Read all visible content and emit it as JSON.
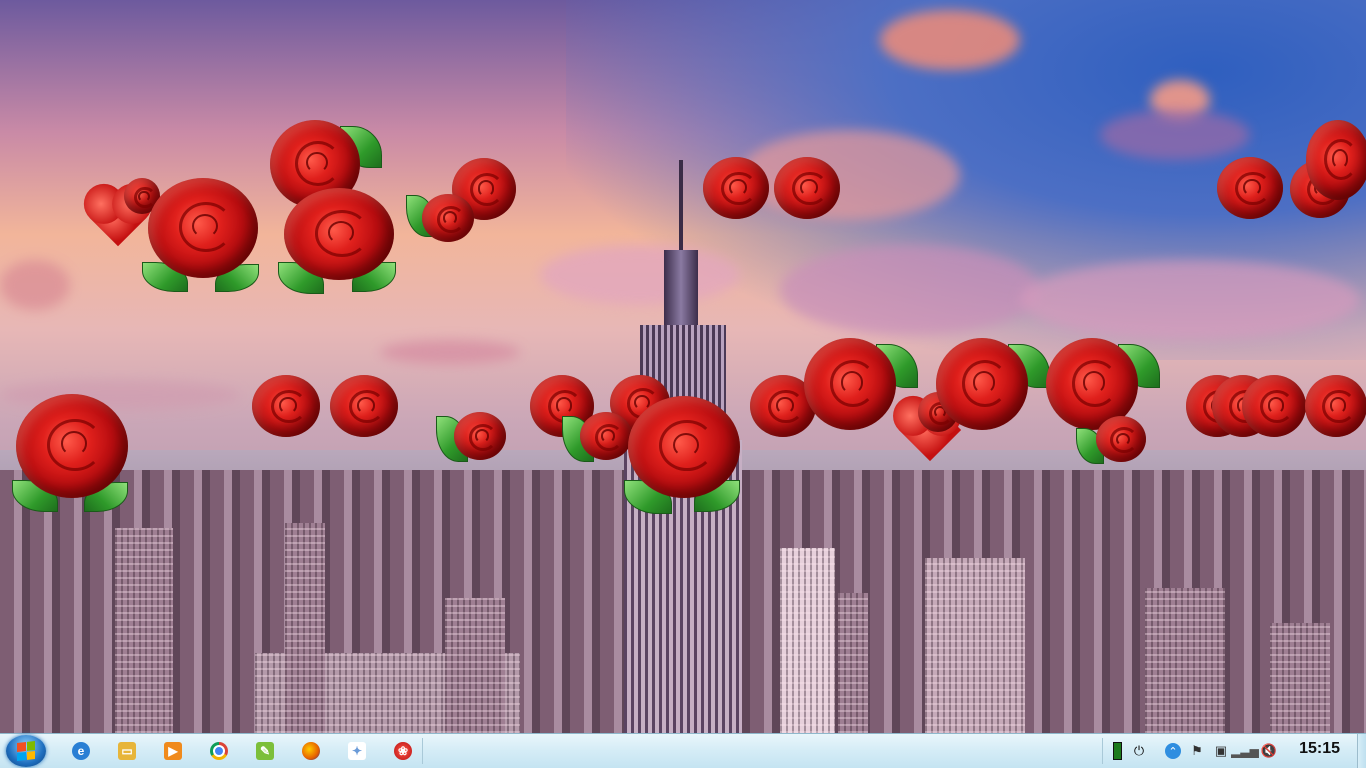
{
  "desktop": {
    "wallpaper": "city-skyline-with-roses"
  },
  "taskbar": {
    "start_button": "windows-orb-icon",
    "pinned": [
      {
        "name": "internet-explorer-icon",
        "color": "#2a7fd4"
      },
      {
        "name": "file-explorer-icon",
        "color": "#e7b53a"
      },
      {
        "name": "media-player-icon",
        "color": "#f08a1c"
      },
      {
        "name": "chrome-icon",
        "color": "#4285f4"
      },
      {
        "name": "notepad-plus-icon",
        "color": "#7cbf3a"
      },
      {
        "name": "firefox-icon",
        "color": "#e66000"
      },
      {
        "name": "paint-icon",
        "color": "#6a9bd8"
      },
      {
        "name": "rose-screensaver-icon",
        "color": "#d11a1a"
      }
    ],
    "tray": [
      "battery-icon",
      "power-plug-icon",
      "show-hidden-icons-icon",
      "action-center-icon",
      "security-icon",
      "network-signal-icon",
      "volume-muted-icon"
    ],
    "clock": "15:15"
  }
}
